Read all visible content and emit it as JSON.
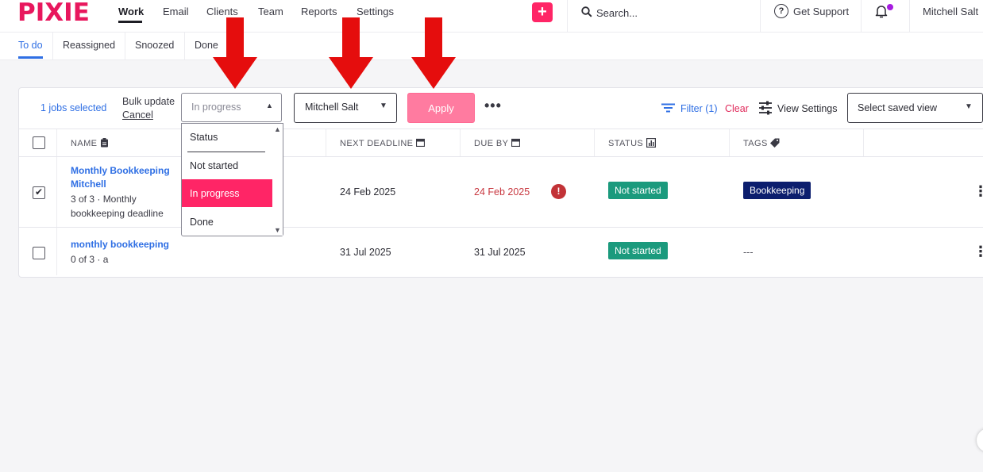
{
  "brand": {
    "logo_text": "PIXIE",
    "accent": "#e8175d"
  },
  "nav": {
    "items": [
      {
        "label": "Work",
        "active": true
      },
      {
        "label": "Email"
      },
      {
        "label": "Clients"
      },
      {
        "label": "Team"
      },
      {
        "label": "Reports"
      },
      {
        "label": "Settings"
      }
    ],
    "add_label": "+",
    "search_placeholder": "Search...",
    "support_label": "Get Support",
    "help_glyph": "?",
    "user_name": "Mitchell Salt"
  },
  "subtabs": [
    {
      "label": "To do",
      "active": true
    },
    {
      "label": "Reassigned"
    },
    {
      "label": "Snoozed"
    },
    {
      "label": "Done"
    }
  ],
  "bulk": {
    "selected_text": "1 jobs selected",
    "bulk_update_label": "Bulk update",
    "cancel_label": "Cancel",
    "status_value": "In progress",
    "assignee_value": "Mitchell Salt",
    "apply_label": "Apply",
    "more_label": "•••",
    "filter_label": "Filter (1)",
    "clear_label": "Clear",
    "view_settings_label": "View Settings",
    "saved_view_placeholder": "Select saved view"
  },
  "status_dropdown": {
    "options": [
      "Status",
      "Not started",
      "In progress",
      "Done"
    ],
    "selected": "In progress",
    "selected_color": "#ff2566"
  },
  "table": {
    "headers": {
      "name": "NAME",
      "next_deadline": "NEXT DEADLINE",
      "due_by": "DUE BY",
      "status": "STATUS",
      "tags": "TAGS"
    },
    "rows": [
      {
        "checked": true,
        "title_line1": "Monthly Bookkeeping",
        "title_line2": "Mitchell",
        "sub_line1": "3 of 3 · Monthly",
        "sub_line2": "bookkeeping deadline",
        "next_deadline": "24 Feb 2025",
        "due_by": "24 Feb 2025",
        "overdue": true,
        "alert_glyph": "!",
        "status": "Not started",
        "tag": "Bookkeeping",
        "menu_glyph": "⋮"
      },
      {
        "checked": false,
        "title_line1": "monthly bookkeeping",
        "sub_line1": "0 of 3 · a",
        "next_deadline": "31 Jul 2025",
        "due_by": "31 Jul 2025",
        "status": "Not started",
        "tag": "---",
        "menu_glyph": "⋮"
      }
    ]
  },
  "colors": {
    "link_blue": "#2f6fe4",
    "status_green": "#1b9a7d",
    "tag_navy": "#0c1e6e",
    "annotation_red": "#e50d0d",
    "apply_pink": "#ff7ba0"
  }
}
